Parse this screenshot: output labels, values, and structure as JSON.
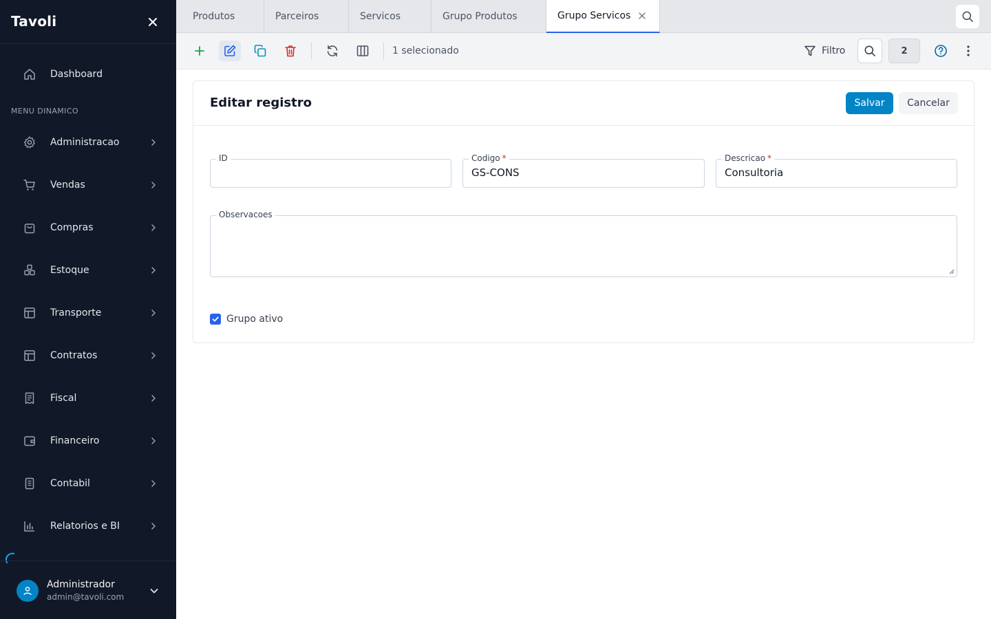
{
  "sidebar": {
    "brand": "Tavoli",
    "dashboard_label": "Dashboard",
    "section_label": "MENU DINAMICO",
    "items": [
      {
        "label": "Administracao",
        "icon": "gear-icon"
      },
      {
        "label": "Vendas",
        "icon": "cart-icon"
      },
      {
        "label": "Compras",
        "icon": "shopping-bag-icon"
      },
      {
        "label": "Estoque",
        "icon": "boxes-icon"
      },
      {
        "label": "Transporte",
        "icon": "layout-icon"
      },
      {
        "label": "Contratos",
        "icon": "layout-icon"
      },
      {
        "label": "Fiscal",
        "icon": "receipt-icon"
      },
      {
        "label": "Financeiro",
        "icon": "wallet-icon"
      },
      {
        "label": "Contabil",
        "icon": "notebook-icon"
      },
      {
        "label": "Relatorios e BI",
        "icon": "bar-chart-icon"
      }
    ],
    "profile": {
      "name": "Administrador",
      "email": "admin@tavoli.com"
    }
  },
  "tabs": [
    {
      "label": "Produtos",
      "active": false
    },
    {
      "label": "Parceiros",
      "active": false
    },
    {
      "label": "Servicos",
      "active": false
    },
    {
      "label": "Grupo Produtos",
      "active": false
    },
    {
      "label": "Grupo Servicos",
      "active": true
    }
  ],
  "toolbar": {
    "selection_text": "1 selecionado",
    "filter_label": "Filtro",
    "count_badge": "2"
  },
  "form": {
    "title": "Editar registro",
    "save_label": "Salvar",
    "cancel_label": "Cancelar",
    "fields": {
      "id": {
        "label": "ID",
        "value": ""
      },
      "codigo": {
        "label": "Codigo",
        "value": "GS-CONS",
        "required_mark": "*"
      },
      "descricao": {
        "label": "Descricao",
        "value": "Consultoria",
        "required_mark": "*"
      },
      "observacoes": {
        "label": "Observacoes",
        "value": ""
      }
    },
    "checkbox": {
      "label": "Grupo ativo",
      "checked": true
    }
  },
  "colors": {
    "sidebar_bg": "#111827",
    "primary": "#0284c7",
    "add": "#16a34a",
    "edit": "#2563eb",
    "copy": "#0891b2",
    "delete": "#dc2626"
  }
}
